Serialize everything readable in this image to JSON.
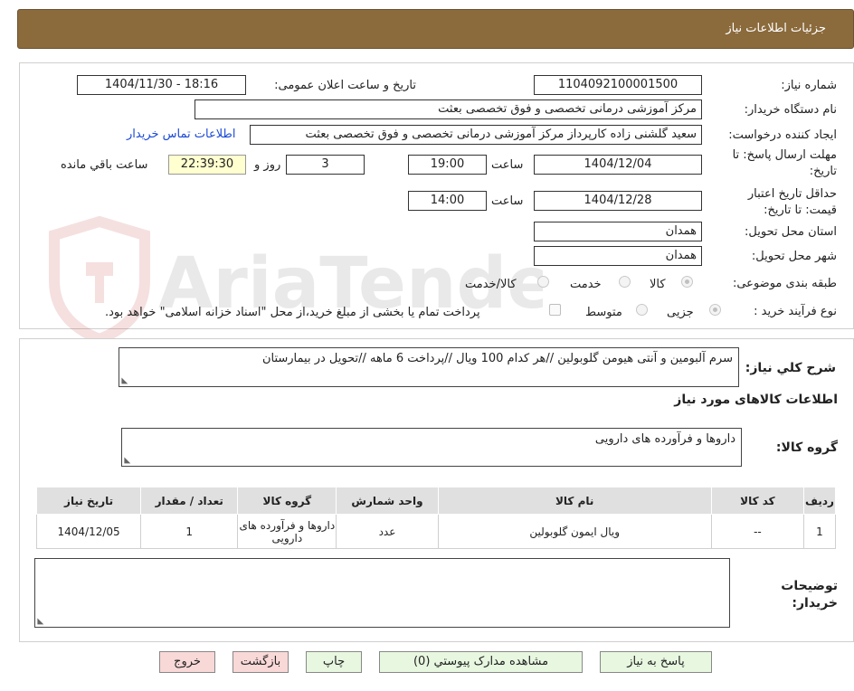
{
  "header": {
    "title": "جزئیات اطلاعات نیاز"
  },
  "form": {
    "need_number_label": "شماره نیاز:",
    "need_number": "1104092100001500",
    "announce_label": "تاریخ و ساعت اعلان عمومی:",
    "announce_value": "1404/11/30 - 18:16",
    "buyer_org_label": "نام دستگاه خریدار:",
    "buyer_org": "مرکز آموزشی درمانی تخصصی و فوق تخصصی بعثت",
    "requester_label": "ایجاد کننده درخواست:",
    "requester": "سعید گلشنی زاده کارپرداز مرکز آموزشی درمانی تخصصی و فوق تخصصی بعثت",
    "contact_link": "اطلاعات تماس خریدار",
    "deadline_label_1": "مهلت ارسال پاسخ: تا",
    "deadline_label_2": "تاریخ:",
    "deadline_date": "1404/12/04",
    "time_label": "ساعت",
    "deadline_time": "19:00",
    "days_value": "3",
    "days_label": "روز و",
    "remaining_time": "22:39:30",
    "remaining_label": "ساعت باقي مانده",
    "validity_label_1": "حداقل تاریخ اعتبار",
    "validity_label_2": "قیمت: تا تاریخ:",
    "validity_date": "1404/12/28",
    "validity_time_label": "ساعت",
    "validity_time": "14:00",
    "province_label": "استان محل تحویل:",
    "province": "همدان",
    "city_label": "شهر محل تحویل:",
    "city": "همدان",
    "category_label": "طبقه بندی موضوعی:",
    "category_options": [
      "کالا",
      "خدمت",
      "کالا/خدمت"
    ],
    "process_label": "نوع فرآیند خرید :",
    "process_options": [
      "جزیی",
      "متوسط"
    ],
    "payment_note": "پرداخت تمام یا بخشی از مبلغ خرید،از محل \"اسناد خزانه اسلامی\" خواهد بود."
  },
  "details": {
    "summary_label": "شرح کلي نیاز:",
    "summary": "سرم آلبومین و آنتی هیومن گلوبولین //هر کدام 100 ویال   //پرداخت 6 ماهه //تحویل در بیمارستان",
    "goods_section": "اطلاعات کالاهای مورد نیاز",
    "goods_group_label": "گروه کالا:",
    "goods_group": "داروها و فرآورده های دارویی",
    "table": {
      "headers": [
        "ردیف",
        "کد کالا",
        "نام کالا",
        "واحد شمارش",
        "گروه کالا",
        "تعداد / مقدار",
        "تاریخ نیاز"
      ],
      "rows": [
        [
          "1",
          "--",
          "ویال ایمون گلوبولین",
          "عدد",
          "داروها و فرآورده های دارویی",
          "1",
          "1404/12/05"
        ]
      ]
    },
    "buyer_notes_label_1": "توضیحات",
    "buyer_notes_label_2": "خریدار:"
  },
  "buttons": {
    "reply": "پاسخ به نیاز",
    "attachments": "مشاهده مدارک پیوستي (0)",
    "print": "چاپ",
    "back": "بازگشت",
    "exit": "خروج"
  },
  "watermark": {
    "text": "AriaTender.neT"
  }
}
